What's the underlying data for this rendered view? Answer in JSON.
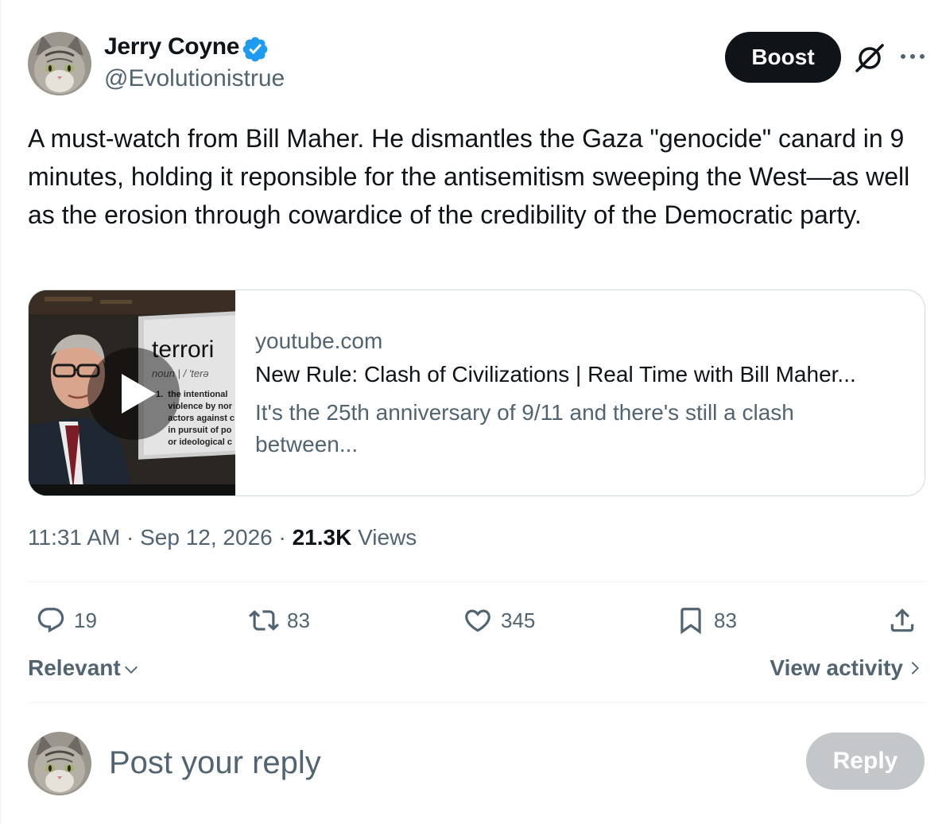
{
  "author": {
    "name": "Jerry Coyne",
    "handle": "@Evolutionistrue",
    "verified": true
  },
  "header": {
    "boost_label": "Boost",
    "grok_icon": "grok-icon",
    "more_icon": "more-icon"
  },
  "tweet": {
    "text": "A must-watch from Bill Maher. He dismantles the Gaza \"genocide\" canard in 9 minutes, holding it reponsible for the antisemitism sweeping the West—as well as the erosion through cowardice of the credibility of the Democratic party."
  },
  "card": {
    "domain": "youtube.com",
    "title": "New Rule: Clash of Civilizations | Real Time with Bill Maher...",
    "description": "It's the 25th anniversary of 9/11 and there's still a clash between...",
    "thumbnail": {
      "word": "terrori",
      "pronunciation": "noun  |  / 'terə",
      "definition": "1.  the intentional\n     violence by nor\n     actors against c\n     in pursuit of po\n     or ideological c"
    }
  },
  "meta": {
    "time": "11:31 AM",
    "separator": "·",
    "date": "Sep 12, 2026",
    "views_count": "21.3K",
    "views_label": "Views"
  },
  "actions": {
    "replies": "19",
    "reposts": "83",
    "likes": "345",
    "bookmarks": "83"
  },
  "sort": {
    "relevant_label": "Relevant",
    "view_activity_label": "View activity"
  },
  "reply": {
    "placeholder": "Post your reply",
    "button_label": "Reply"
  },
  "colors": {
    "verified": "#1d9bf0",
    "text_primary": "#0f1419",
    "text_secondary": "#536471",
    "border": "#cfd9de",
    "reply_disabled": "#c4c7ca"
  }
}
